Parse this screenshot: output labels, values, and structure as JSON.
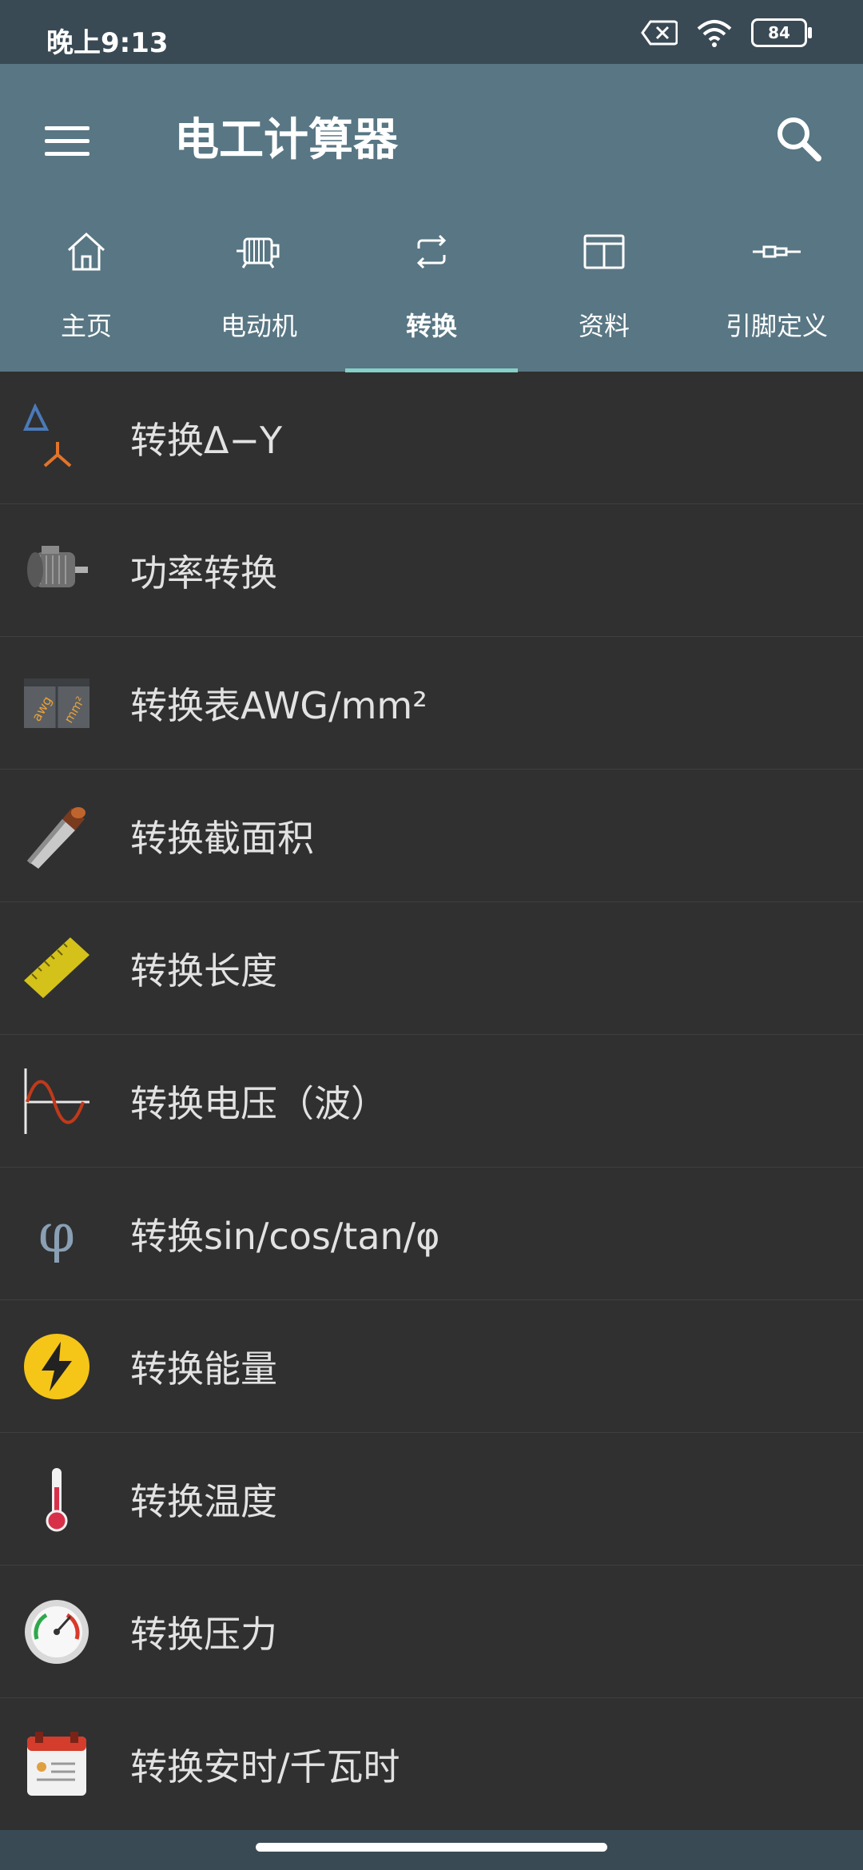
{
  "status": {
    "time": "晚上9:13",
    "battery": "84",
    "icons": [
      "sim-off-icon",
      "wifi-icon",
      "battery-icon"
    ]
  },
  "appbar": {
    "title": "电工计算器",
    "menu_icon": "menu-icon",
    "search_icon": "search-icon"
  },
  "tabs": [
    {
      "label": "主页",
      "icon": "home-icon",
      "active": false
    },
    {
      "label": "电动机",
      "icon": "motor-icon",
      "active": false
    },
    {
      "label": "转换",
      "icon": "convert-icon",
      "active": true
    },
    {
      "label": "资料",
      "icon": "table-icon",
      "active": false
    },
    {
      "label": "引脚定义",
      "icon": "connector-icon",
      "active": false
    }
  ],
  "items": [
    {
      "label": "转换Δ−Y",
      "icon": "delta-star-icon"
    },
    {
      "label": "功率转换",
      "icon": "electric-motor-icon"
    },
    {
      "label": "转换表AWG/mm²",
      "icon": "awg-mm2-icon"
    },
    {
      "label": "转换截面积",
      "icon": "cable-icon"
    },
    {
      "label": "转换长度",
      "icon": "ruler-icon"
    },
    {
      "label": "转换电压（波）",
      "icon": "sine-wave-icon"
    },
    {
      "label": "转换sin/cos/tan/φ",
      "icon": "phi-icon"
    },
    {
      "label": "转换能量",
      "icon": "lightning-icon"
    },
    {
      "label": "转换温度",
      "icon": "thermometer-icon"
    },
    {
      "label": "转换压力",
      "icon": "pressure-gauge-icon"
    },
    {
      "label": "转换安时/千瓦时",
      "icon": "battery-calendar-icon"
    }
  ],
  "colors": {
    "appbar": "#587683",
    "statusbar": "#3a4a54",
    "background": "#303030",
    "tab_indicator": "#86d0c8"
  }
}
